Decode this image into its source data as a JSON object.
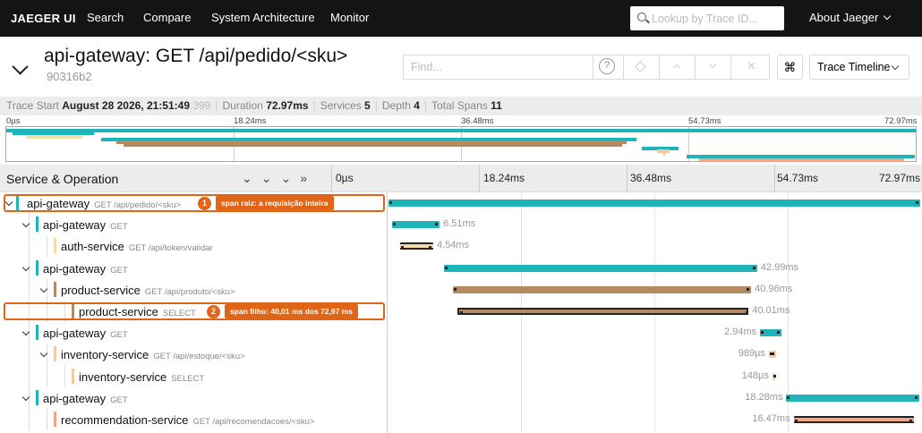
{
  "nav": {
    "logo": "JAEGER UI",
    "links": [
      "Search",
      "Compare",
      "System Architecture",
      "Monitor"
    ],
    "search_placeholder": "Lookup by Trace ID...",
    "about": "About Jaeger"
  },
  "header": {
    "title": "api-gateway: GET /api/pedido/<sku>",
    "trace_id": "90316b2",
    "find_placeholder": "Find...",
    "help": "?",
    "shortcut": "⌘",
    "view": "Trace Timeline"
  },
  "summary": {
    "trace_start_label": "Trace Start",
    "trace_start_value": "August 28 2026, 21:51:49",
    "trace_start_ms": ".399",
    "duration_label": "Duration",
    "duration_value": "72.97ms",
    "services_label": "Services",
    "services_value": "5",
    "depth_label": "Depth",
    "depth_value": "4",
    "total_spans_label": "Total Spans",
    "total_spans_value": "11"
  },
  "ticks": [
    "0µs",
    "18.24ms",
    "36.48ms",
    "54.73ms",
    "72.97ms"
  ],
  "tree_header": {
    "title": "Service & Operation"
  },
  "colors": {
    "api-gateway": "#1fb5b8",
    "auth-service": "#f5dba8",
    "product-service": "#b58a63",
    "inventory-service": "#f7c9a0",
    "recommendation-service": "#f2a48a",
    "highlight": "#e06516"
  },
  "spans": [
    {
      "service": "api-gateway",
      "operation": "GET /api/pedido/<sku>",
      "depth": 0,
      "has_children": true,
      "start_ms": 0,
      "duration_ms": 72.97,
      "duration_label": ""
    },
    {
      "service": "api-gateway",
      "operation": "GET",
      "depth": 1,
      "has_children": true,
      "start_ms": 0.5,
      "duration_ms": 6.51,
      "duration_label": "6.51ms"
    },
    {
      "service": "auth-service",
      "operation": "GET /api/token/validar",
      "depth": 2,
      "has_children": false,
      "start_ms": 1.6,
      "duration_ms": 4.54,
      "duration_label": "4.54ms"
    },
    {
      "service": "api-gateway",
      "operation": "GET",
      "depth": 1,
      "has_children": true,
      "start_ms": 7.6,
      "duration_ms": 42.99,
      "duration_label": "42.99ms"
    },
    {
      "service": "product-service",
      "operation": "GET /api/produto/<sku>",
      "depth": 2,
      "has_children": true,
      "start_ms": 8.8,
      "duration_ms": 40.96,
      "duration_label": "40.96ms"
    },
    {
      "service": "product-service",
      "operation": "SELECT",
      "depth": 3,
      "has_children": false,
      "start_ms": 9.4,
      "duration_ms": 40.01,
      "duration_label": "40.01ms"
    },
    {
      "service": "api-gateway",
      "operation": "GET",
      "depth": 1,
      "has_children": true,
      "start_ms": 51.0,
      "duration_ms": 2.94,
      "duration_label": "2.94ms"
    },
    {
      "service": "inventory-service",
      "operation": "GET /api/estoque/<sku>",
      "depth": 2,
      "has_children": true,
      "start_ms": 52.2,
      "duration_ms": 0.989,
      "duration_label": "989µs"
    },
    {
      "service": "inventory-service",
      "operation": "SELECT",
      "depth": 3,
      "has_children": false,
      "start_ms": 52.7,
      "duration_ms": 0.148,
      "duration_label": "148µs"
    },
    {
      "service": "api-gateway",
      "operation": "GET",
      "depth": 1,
      "has_children": true,
      "start_ms": 54.6,
      "duration_ms": 18.28,
      "duration_label": "18.28ms"
    },
    {
      "service": "recommendation-service",
      "operation": "GET /api/recomendacoes/<sku>",
      "depth": 2,
      "has_children": false,
      "start_ms": 55.6,
      "duration_ms": 16.47,
      "duration_label": "16.47ms"
    }
  ],
  "annotations": [
    {
      "number": "1",
      "text": "span raiz: a requisição inteira"
    },
    {
      "number": "2",
      "text": "span filho: 40,01 ms dos 72,97 ms"
    }
  ]
}
